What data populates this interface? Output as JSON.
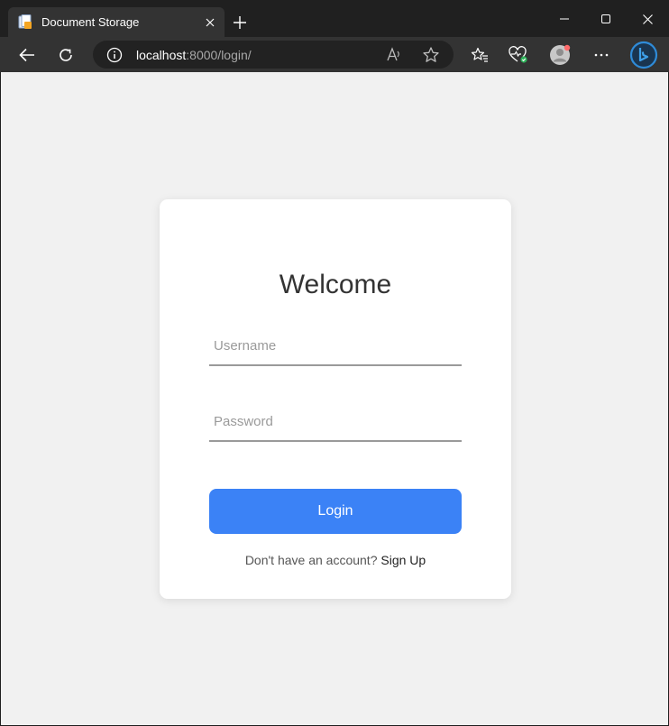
{
  "browser": {
    "tab_title": "Document Storage",
    "url_host": "localhost",
    "url_rest": ":8000/login/"
  },
  "login": {
    "heading": "Welcome",
    "username_placeholder": "Username",
    "password_placeholder": "Password",
    "login_button": "Login",
    "signup_prompt": "Don't have an account?",
    "signup_link": "Sign Up"
  },
  "colors": {
    "primary": "#3b82f6",
    "page_background": "#f1f1f1",
    "browser_frame": "#202020"
  }
}
